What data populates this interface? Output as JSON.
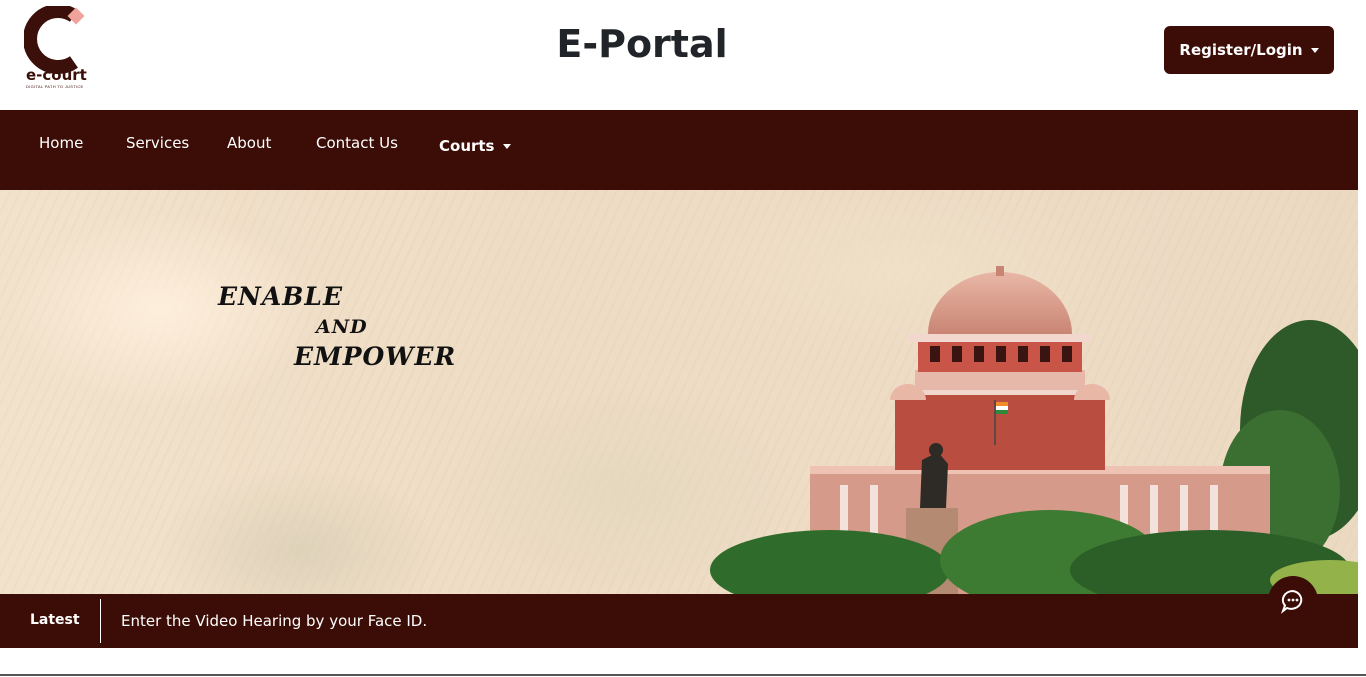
{
  "header": {
    "logo_text": "e-court",
    "logo_tagline": "DIGITAL PATH TO JUSTICE",
    "title": "E-Portal",
    "login_label": "Register/Login"
  },
  "nav": {
    "items": [
      {
        "label": "Home"
      },
      {
        "label": "Services"
      },
      {
        "label": "About"
      },
      {
        "label": "Contact Us"
      },
      {
        "label": "Courts"
      }
    ]
  },
  "hero": {
    "line1": "ENABLE",
    "line2": "AND",
    "line3": "EMPOWER"
  },
  "ticker": {
    "label": "Latest",
    "message": "Enter the Video Hearing by your Face ID."
  },
  "icons": {
    "logo": "ecourt-logo-icon",
    "dropdown": "caret-down-icon",
    "chat": "chat-bubble-icon"
  },
  "colors": {
    "brand": "#3c0d06",
    "logo_accent": "#f0a39a",
    "text": "#212529"
  }
}
